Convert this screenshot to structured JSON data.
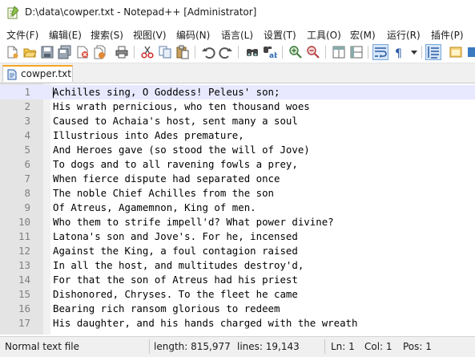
{
  "window": {
    "title": "D:\\data\\cowper.txt - Notepad++ [Administrator]",
    "icon": "notepad-plus-plus-icon"
  },
  "menu": [
    "文件(F)",
    "编辑(E)",
    "搜索(S)",
    "视图(V)",
    "编码(N)",
    "语言(L)",
    "设置(T)",
    "工具(O)",
    "宏(M)",
    "运行(R)",
    "插件(P)"
  ],
  "toolbar": {
    "buttons": [
      "new-file-icon",
      "open-file-icon",
      "save-icon",
      "save-all-icon",
      "close-icon",
      "close-all-icon",
      "print-icon",
      "cut-icon",
      "copy-icon",
      "paste-icon",
      "undo-icon",
      "redo-icon",
      "find-icon",
      "replace-icon",
      "zoom-in-icon",
      "zoom-out-icon",
      "sync-vertical-icon",
      "sync-horizontal-icon",
      "word-wrap-icon",
      "show-all-characters-icon",
      "dropdown-icon",
      "indent-guide-icon",
      "folder-icon"
    ]
  },
  "tabs": [
    {
      "label": "cowper.txt",
      "icon": "file-icon",
      "active": true
    }
  ],
  "editor": {
    "current_line": 1,
    "lines": [
      {
        "num": "1",
        "text": "Achilles sing, O Goddess! Peleus' son;"
      },
      {
        "num": "2",
        "text": "His wrath pernicious, who ten thousand woes"
      },
      {
        "num": "3",
        "text": "Caused to Achaia's host, sent many a soul"
      },
      {
        "num": "4",
        "text": "Illustrious into Ades premature,"
      },
      {
        "num": "5",
        "text": "And Heroes gave (so stood the will of Jove)"
      },
      {
        "num": "6",
        "text": "To dogs and to all ravening fowls a prey,"
      },
      {
        "num": "7",
        "text": "When fierce dispute had separated once"
      },
      {
        "num": "8",
        "text": "The noble Chief Achilles from the son"
      },
      {
        "num": "9",
        "text": "Of Atreus, Agamemnon, King of men."
      },
      {
        "num": "10",
        "text": "Who them to strife impell'd? What power divine?"
      },
      {
        "num": "11",
        "text": "Latona's son and Jove's. For he, incensed"
      },
      {
        "num": "12",
        "text": "Against the King, a foul contagion raised"
      },
      {
        "num": "13",
        "text": "In all the host, and multitudes destroy'd,"
      },
      {
        "num": "14",
        "text": "For that the son of Atreus had his priest"
      },
      {
        "num": "15",
        "text": "Dishonored, Chryses. To the fleet he came"
      },
      {
        "num": "16",
        "text": "Bearing rich ransom glorious to redeem"
      },
      {
        "num": "17",
        "text": "His daughter, and his hands charged with the wreath"
      }
    ]
  },
  "status": {
    "file_type": "Normal text file",
    "length": "length: 815,977",
    "lines": "lines: 19,143",
    "ln": "Ln: 1",
    "col": "Col: 1",
    "pos": "Pos: 1"
  },
  "colors": {
    "current_line": "#e8e8ff",
    "gutter": "#e4e4e4",
    "tab_accent": "#f5a623"
  }
}
